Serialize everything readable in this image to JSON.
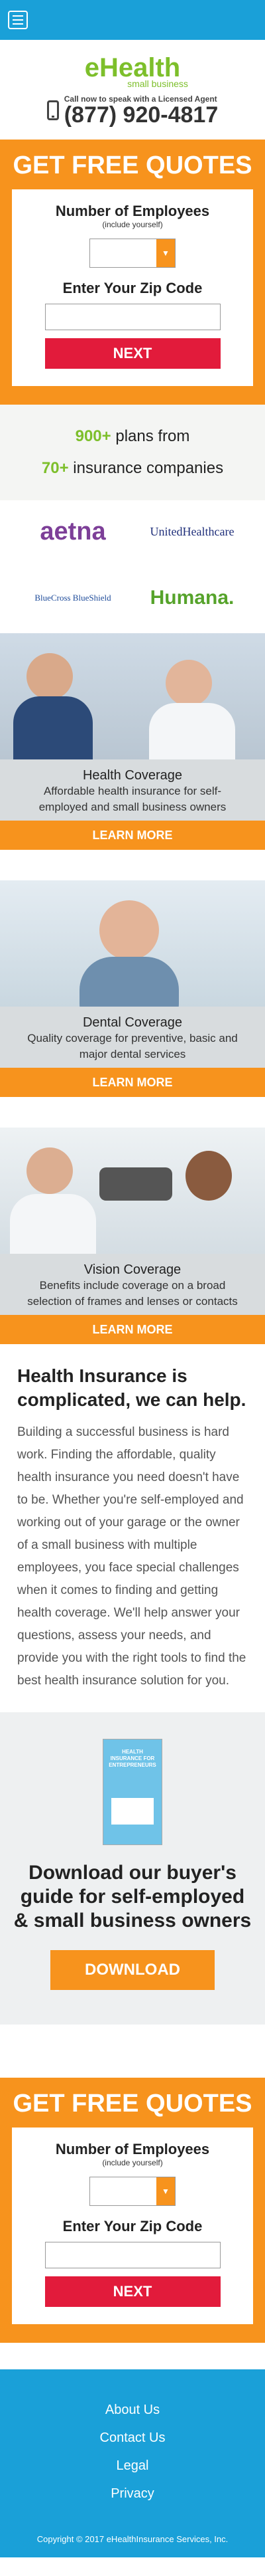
{
  "header": {
    "menu_icon": "hamburger-icon"
  },
  "brand": {
    "logo_main": "eHealth",
    "logo_sub": "small business",
    "call_text": "Call now to speak with a Licensed Agent",
    "phone": "(877) 920-4817",
    "phone_icon": "mobile-phone-icon"
  },
  "quote_form": {
    "title": "GET FREE QUOTES",
    "employees_label": "Number of Employees",
    "employees_sub": "(include yourself)",
    "zip_label": "Enter Your Zip Code",
    "next_label": "NEXT"
  },
  "plans": {
    "line1_num": "900+",
    "line1_text": " plans from",
    "line2_num": "70+",
    "line2_text": " insurance companies"
  },
  "carriers": [
    "aetna",
    "UnitedHealthcare",
    "BlueCross BlueShield",
    "Humana."
  ],
  "coverage": [
    {
      "title": "Health Coverage",
      "desc": "Affordable health insurance for self-employed and small business owners",
      "button": "LEARN MORE"
    },
    {
      "title": "Dental Coverage",
      "desc": "Quality coverage for preventive, basic and major dental services",
      "button": "LEARN MORE"
    },
    {
      "title": "Vision Coverage",
      "desc": "Benefits include coverage on a broad selection of frames and lenses or contacts",
      "button": "LEARN MORE"
    }
  ],
  "info": {
    "title": "Health Insurance is complicated, we can help.",
    "body": "Building a successful business is hard work. Finding the affordable, quality health insurance you need doesn't have to be. Whether you're self-employed and working out of your garage or the owner of a small business with multiple employees, you face special challenges when it comes to finding and getting health coverage. We'll help answer your questions, assess your needs, and provide you with the right tools to find the best health insurance solution for you."
  },
  "guide": {
    "book_title": "HEALTH INSURANCE FOR ENTREPRENEURS",
    "title": "Download our buyer's guide for self-employed & small business owners",
    "button": "DOWNLOAD"
  },
  "footer": {
    "links": [
      "About Us",
      "Contact Us",
      "Legal",
      "Privacy"
    ],
    "copyright": "Copyright © 2017 eHealthInsurance Services, Inc."
  },
  "colors": {
    "header_blue": "#1aa0d8",
    "orange": "#f7931d",
    "green": "#7dbf2b",
    "red": "#e21b3b"
  }
}
